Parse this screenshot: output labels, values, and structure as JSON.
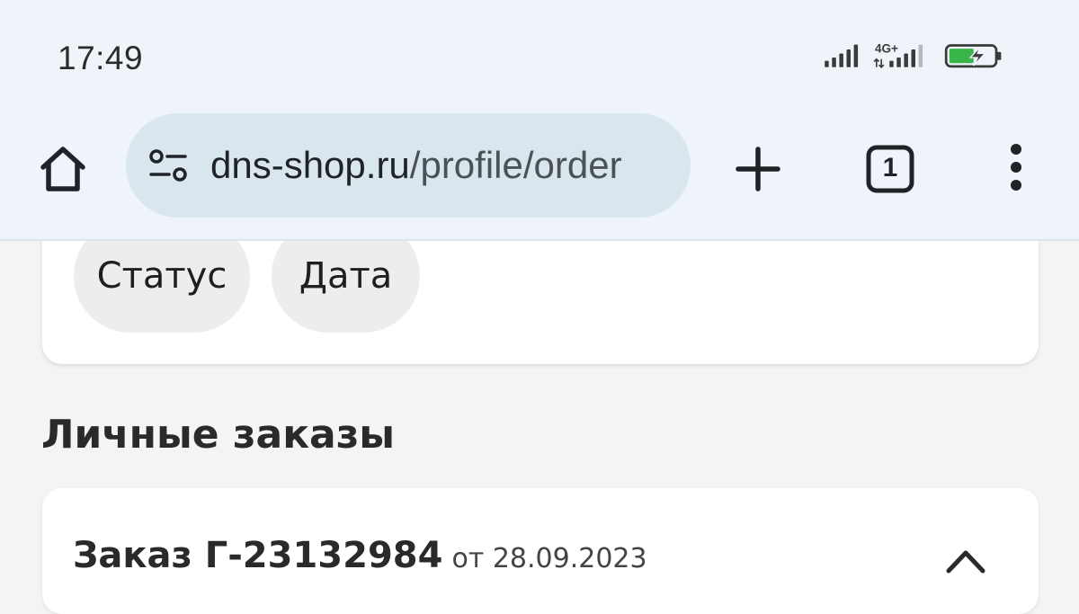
{
  "status_bar": {
    "time": "17:49",
    "network": "4G+",
    "icons": [
      "signal-icon",
      "signal-4g-icon",
      "battery-charging-icon"
    ],
    "battery_color": "#39b54a"
  },
  "browser": {
    "url_domain": "dns-shop.ru",
    "url_path": "/profile/order",
    "tab_count": "1",
    "icons": [
      "home-icon",
      "site-settings-icon",
      "new-tab-icon",
      "tabs-icon",
      "more-vert-icon"
    ]
  },
  "filters": {
    "chips": [
      "Статус",
      "Дата"
    ]
  },
  "orders_section": {
    "title": "Личные заказы",
    "order": {
      "number": "Заказ Г-23132984",
      "date": "от 28.09.2023",
      "toggle_icon": "chevron-up-icon"
    }
  },
  "colors": {
    "chrome_bg": "#eef4f9",
    "urlbar_bg": "#d9e6ee",
    "page_bg": "#f4f4f4",
    "chip_bg": "#ededed"
  }
}
